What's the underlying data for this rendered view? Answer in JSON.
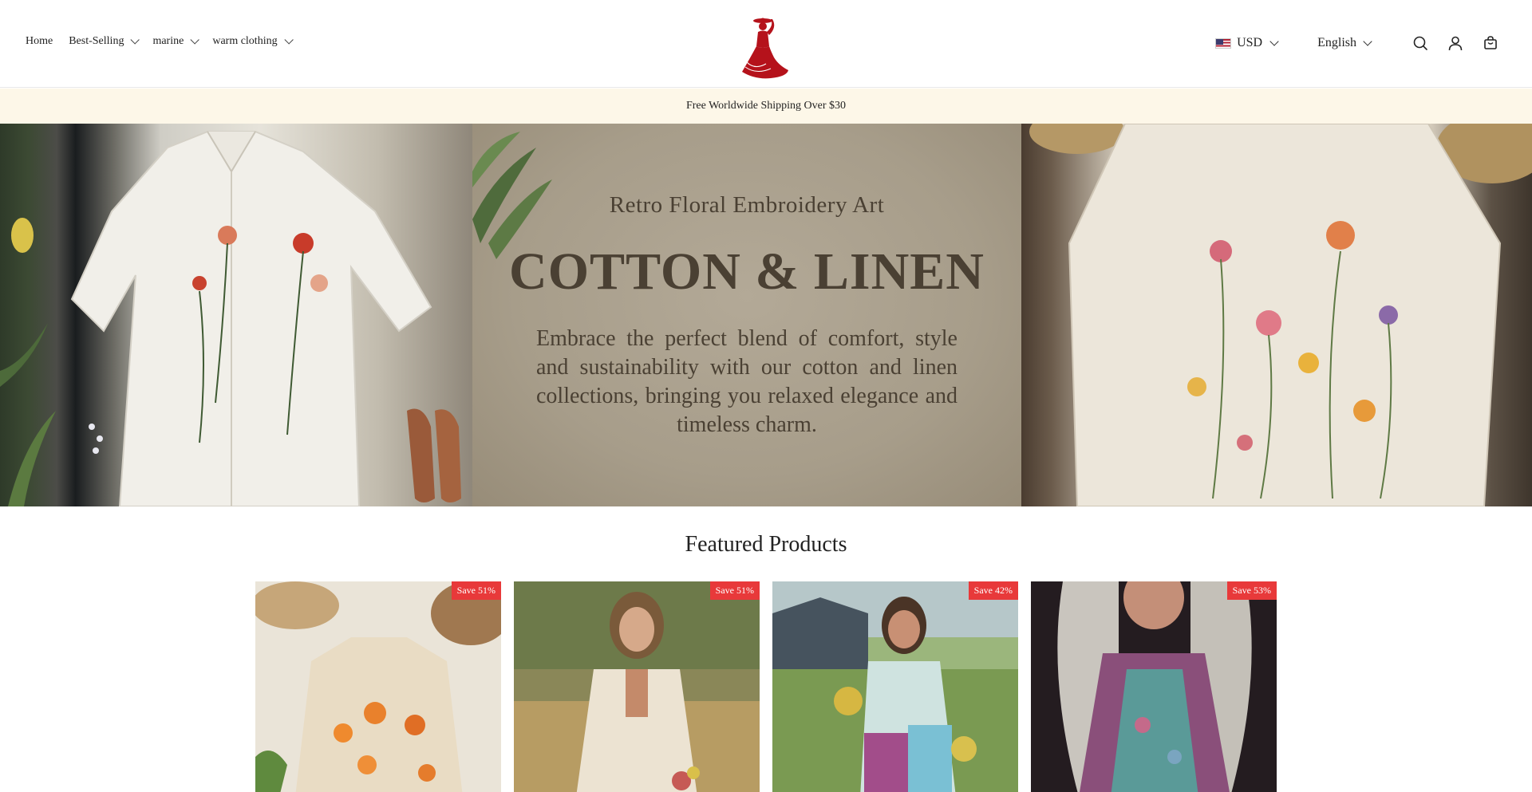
{
  "nav": {
    "items": [
      {
        "label": "Home",
        "caret": false
      },
      {
        "label": "Best-Selling",
        "caret": true
      },
      {
        "label": "marine",
        "caret": true
      },
      {
        "label": "warm clothing",
        "caret": true
      }
    ]
  },
  "header": {
    "currency": "USD",
    "language": "English",
    "icons": [
      "search-icon",
      "account-icon",
      "cart-icon",
      "logo-icon",
      "us-flag-icon"
    ]
  },
  "announcement": "Free Worldwide Shipping Over $30",
  "hero": {
    "subtitle": "Retro Floral Embroidery Art",
    "title": "COTTON & LINEN",
    "description": "Embrace the perfect blend of comfort, style and sustainability with our cotton and linen collections, bringing you relaxed elegance and timeless charm."
  },
  "featured": {
    "title": "Featured Products",
    "products": [
      {
        "badge": "Save 51%"
      },
      {
        "badge": "Save 51%"
      },
      {
        "badge": "Save 42%"
      },
      {
        "badge": "Save 53%"
      }
    ]
  },
  "colors": {
    "accent": "#e8393a",
    "logo": "#b5121b",
    "announcement_bg": "#fdf7e8",
    "hero_text": "#4a4033"
  }
}
